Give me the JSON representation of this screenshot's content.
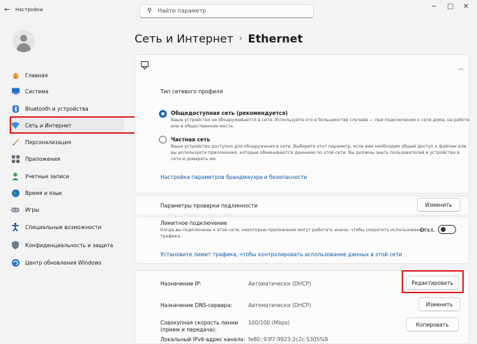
{
  "window": {
    "app_title": "Настройки",
    "search_placeholder": "Найти параметр",
    "back_glyph": "←",
    "minimize_glyph": "−",
    "maximize_glyph": "□",
    "close_glyph": "✕"
  },
  "sidebar": {
    "items": [
      {
        "label": "Главная",
        "icon": "home-icon"
      },
      {
        "label": "Система",
        "icon": "system-icon"
      },
      {
        "label": "Bluetooth и устройства",
        "icon": "bluetooth-icon"
      },
      {
        "label": "Сеть и Интернет",
        "icon": "network-icon",
        "active": true
      },
      {
        "label": "Персонализация",
        "icon": "brush-icon"
      },
      {
        "label": "Приложения",
        "icon": "apps-icon"
      },
      {
        "label": "Учетные записи",
        "icon": "account-icon"
      },
      {
        "label": "Время и язык",
        "icon": "globe-icon"
      },
      {
        "label": "Игры",
        "icon": "gamepad-icon"
      },
      {
        "label": "Специальные возможности",
        "icon": "accessibility-icon"
      },
      {
        "label": "Конфиденциальность и защита",
        "icon": "shield-icon"
      },
      {
        "label": "Центр обновления Windows",
        "icon": "update-icon"
      }
    ]
  },
  "header": {
    "breadcrumb_parent": "Сеть и Интернет",
    "breadcrumb_sep": "›",
    "breadcrumb_current": "Ethernet"
  },
  "profile_section": {
    "title": "Тип сетевого профиля",
    "public_label": "Общедоступная сеть (рекомендуется)",
    "public_desc_1": "Ваше устройство не обнаруживается в сети. Используйте это в большинстве случаев — при подключении к сети дома, на работе",
    "public_desc_2": "или в общественном месте.",
    "private_label": "Частная сеть",
    "private_desc_1": "Ваше устройство доступно для обнаружения в сети. Выберите этот параметр, если вам необходим общий доступ к файлам или",
    "private_desc_2": "вы используете приложения, которые обмениваются данными по этой сети. Вы должны знать пользователей и устройства в",
    "private_desc_3": "сети и доверять им.",
    "firewall_link": "Настройка параметров брандмауэра и безопасности"
  },
  "auth": {
    "label": "Параметры проверки подлинности",
    "button": "Изменить"
  },
  "metered": {
    "label": "Лимитное подключение",
    "desc_1": "Когда вы подключены к этой сети, некоторые приложения могут работать иначе, чтобы сократить использование",
    "desc_2": "трафика.",
    "state": "Откл.",
    "enabled": false,
    "limit_link": "Установите лимит трафика, чтобы контролировать использование данных в этой сети"
  },
  "ip": {
    "ip_label": "Назначение IP:",
    "ip_value": "Автоматически (DHCP)",
    "ip_button": "Редактировать",
    "dns_label": "Назначение DNS-сервера:",
    "dns_value": "Автоматически (DHCP)",
    "dns_button": "Изменить",
    "speed_label_1": "Совокупная скорость линии",
    "speed_label_2": "(прием и передача):",
    "speed_value": "100/100 (Mbps)",
    "copy_button": "Копировать",
    "ipv6_label": "Локальный IPv6-адрес канала:",
    "ipv6_value": "fe80::93f7:9923:2c2c:5305%8"
  },
  "colors": {
    "accent": "#0a5fc2",
    "highlight": "#e0161b",
    "link": "#0b57a8"
  }
}
